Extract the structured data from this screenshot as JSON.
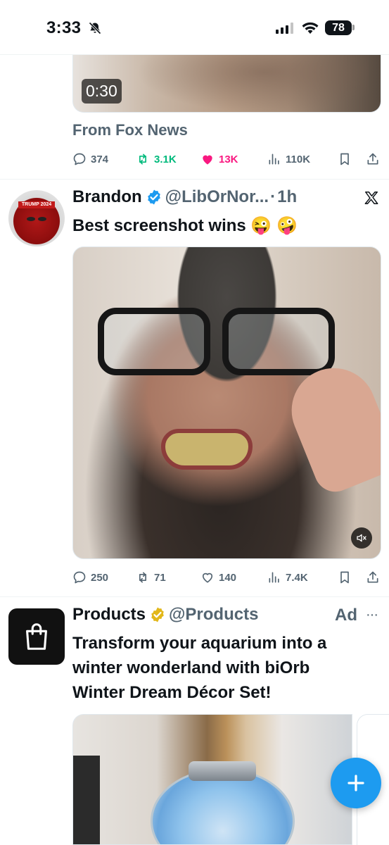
{
  "status_bar": {
    "time": "3:33",
    "battery": "78",
    "icons": [
      "bell-slash-icon",
      "cellular-signal-icon",
      "wifi-icon",
      "battery-icon"
    ]
  },
  "tweet1": {
    "video_duration": "0:30",
    "source": "From Fox News",
    "replies": "374",
    "retweets": "3.1K",
    "likes": "13K",
    "views": "110K",
    "retweeted": true,
    "liked": true
  },
  "tweet2": {
    "name": "Brandon",
    "handle": "@LibOrNor...",
    "time_sep": "·",
    "time": "1h",
    "text": "Best screenshot wins 😜 🤪",
    "replies": "250",
    "retweets": "71",
    "likes": "140",
    "views": "7.4K",
    "avatar_banner": "TRUMP 2024"
  },
  "ad_tweet": {
    "name": "Products",
    "handle": "@Products",
    "ad_label": "Ad",
    "more": "···",
    "text_lines": [
      "Transform your aquarium into a",
      "winter wonderland with biOrb",
      "Winter Dream Décor Set!"
    ]
  },
  "colors": {
    "accent": "#1d9bf0",
    "retweet_green": "#00ba7c",
    "like_pink": "#f91880",
    "secondary_text": "#536471",
    "gold_badge": "#e2b719"
  }
}
